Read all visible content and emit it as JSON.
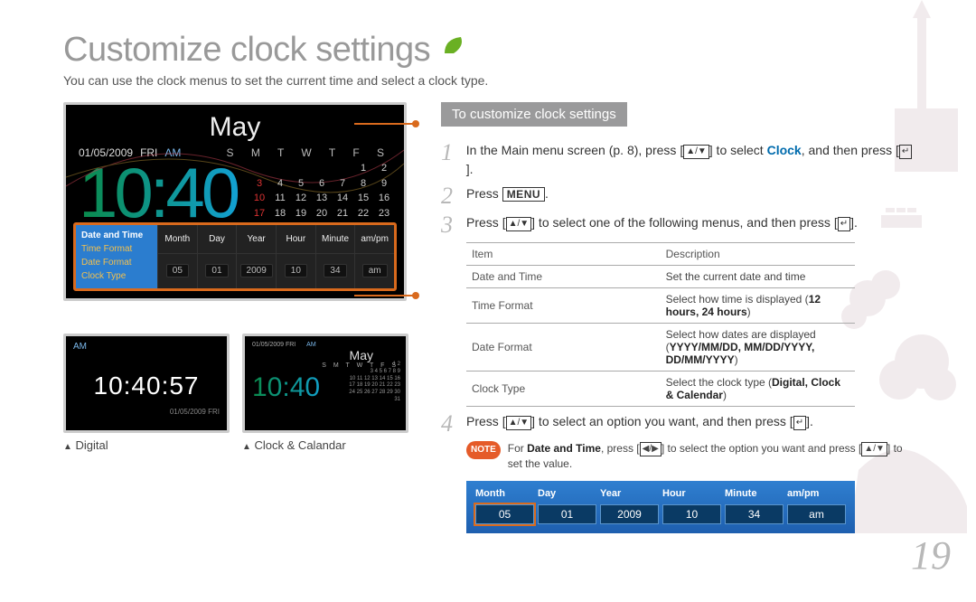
{
  "page": {
    "title": "Customize clock settings",
    "subtitle": "You can use the clock menus to set the current time and select a clock type.",
    "number": "19"
  },
  "screenshot_main": {
    "month": "May",
    "date": "01/05/2009",
    "weekday": "FRI",
    "ampm": "AM",
    "dow_header": "S M T W T F S",
    "time": "10:40",
    "cal_rows": [
      [
        "",
        "",
        "",
        "",
        "",
        "1",
        "2"
      ],
      [
        "3",
        "4",
        "5",
        "6",
        "7",
        "8",
        "9"
      ],
      [
        "10",
        "11",
        "12",
        "13",
        "14",
        "15",
        "16"
      ],
      [
        "17",
        "18",
        "19",
        "20",
        "21",
        "22",
        "23"
      ]
    ],
    "side_menu": [
      "Date and Time",
      "Time Format",
      "Date Format",
      "Clock Type"
    ],
    "fields": {
      "headers": [
        "Month",
        "Day",
        "Year",
        "Hour",
        "Minute",
        "am/pm"
      ],
      "values": [
        "05",
        "01",
        "2009",
        "10",
        "34",
        "am"
      ]
    }
  },
  "thumbs": {
    "digital": {
      "am": "AM",
      "time": "10:40:57",
      "date": "01/05/2009  FRI",
      "caption": "Digital"
    },
    "cc": {
      "date": "01/05/2009  FRI",
      "am": "AM",
      "month": "May",
      "time": "10:40",
      "dow": "S M T W T F S",
      "mini_rows": [
        "1 2",
        "3 4 5 6 7 8 9",
        "10 11 12 13 14 15 16",
        "17 18 19 20 21 22 23",
        "24 25 26 27 28 29 30",
        "31"
      ],
      "caption": "Clock & Calandar"
    }
  },
  "right": {
    "banner": "To customize clock settings",
    "step1_a": "In the Main menu screen (p. 8), press ",
    "step1_b": " to select ",
    "step1_clock": "Clock",
    "step1_c": ", and then press ",
    "step2_a": "Press ",
    "menu_key": "MENU",
    "step3_a": "Press ",
    "step3_b": " to select one of the following menus, and then press ",
    "table": {
      "h1": "Item",
      "h2": "Description",
      "rows": [
        {
          "item": "Date and Time",
          "desc_a": "Set the current date and time",
          "bold": ""
        },
        {
          "item": "Time Format",
          "desc_a": "Select how time is displayed (",
          "bold": "12 hours, 24 hours",
          "desc_b": ")"
        },
        {
          "item": "Date Format",
          "desc_a": "Select how dates are displayed (",
          "bold": "YYYY/MM/DD, MM/DD/YYYY, DD/MM/YYYY",
          "desc_b": ")"
        },
        {
          "item": "Clock Type",
          "desc_a": "Select the clock type (",
          "bold": "Digital, Clock & Calendar",
          "desc_b": ")"
        }
      ]
    },
    "step4_a": "Press ",
    "step4_b": " to select an option you want, and then press ",
    "note_label": "NOTE",
    "note_a": "For ",
    "note_bold": "Date and Time",
    "note_b": ", press ",
    "note_c": " to select the option you want and press ",
    "note_d": " to set the value."
  },
  "blue_strip": {
    "headers": [
      "Month",
      "Day",
      "Year",
      "Hour",
      "Minute",
      "am/pm"
    ],
    "values": [
      "05",
      "01",
      "2009",
      "10",
      "34",
      "am"
    ],
    "selected_index": 0
  }
}
